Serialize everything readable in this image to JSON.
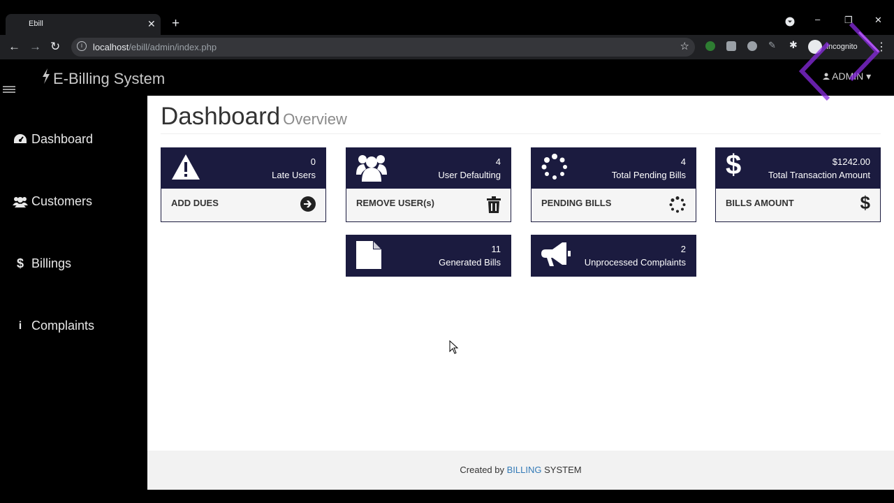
{
  "browser": {
    "tab_title": "Ebill",
    "url_host": "localhost",
    "url_path": "/ebill/admin/index.php",
    "profile_label": "Incognito"
  },
  "app": {
    "brand": "E-Billing System",
    "user_menu": "ADMIN"
  },
  "sidebar": {
    "items": [
      {
        "label": "Dashboard",
        "icon": "dashboard-icon"
      },
      {
        "label": "Customers",
        "icon": "users-icon"
      },
      {
        "label": "Billings",
        "icon": "dollar-icon"
      },
      {
        "label": "Complaints",
        "icon": "info-icon"
      }
    ]
  },
  "page": {
    "title": "Dashboard",
    "subtitle": "Overview"
  },
  "cards": [
    {
      "value": "0",
      "label": "Late Users",
      "link": "ADD DUES",
      "icon": "warning-icon",
      "link_icon": "arrow-right-circle-icon"
    },
    {
      "value": "4",
      "label": "User Defaulting",
      "link": "REMOVE USER(s)",
      "icon": "users-icon",
      "link_icon": "trash-icon"
    },
    {
      "value": "4",
      "label": "Total Pending Bills",
      "link": "PENDING BILLS",
      "icon": "spinner-icon",
      "link_icon": "spinner-icon"
    },
    {
      "value": "$1242.00",
      "label": "Total Transaction Amount",
      "link": "BILLS AMOUNT",
      "icon": "dollar-icon",
      "link_icon": "dollar-icon"
    },
    {
      "value": "11",
      "label": "Generated Bills",
      "icon": "file-icon"
    },
    {
      "value": "2",
      "label": "Unprocessed Complaints",
      "icon": "bullhorn-icon"
    }
  ],
  "footer": {
    "prefix": "Created by",
    "highlight": "BILLING",
    "suffix": "SYSTEM"
  },
  "colors": {
    "card_header": "#1b1b3f",
    "footer_link": "#337ab7"
  }
}
